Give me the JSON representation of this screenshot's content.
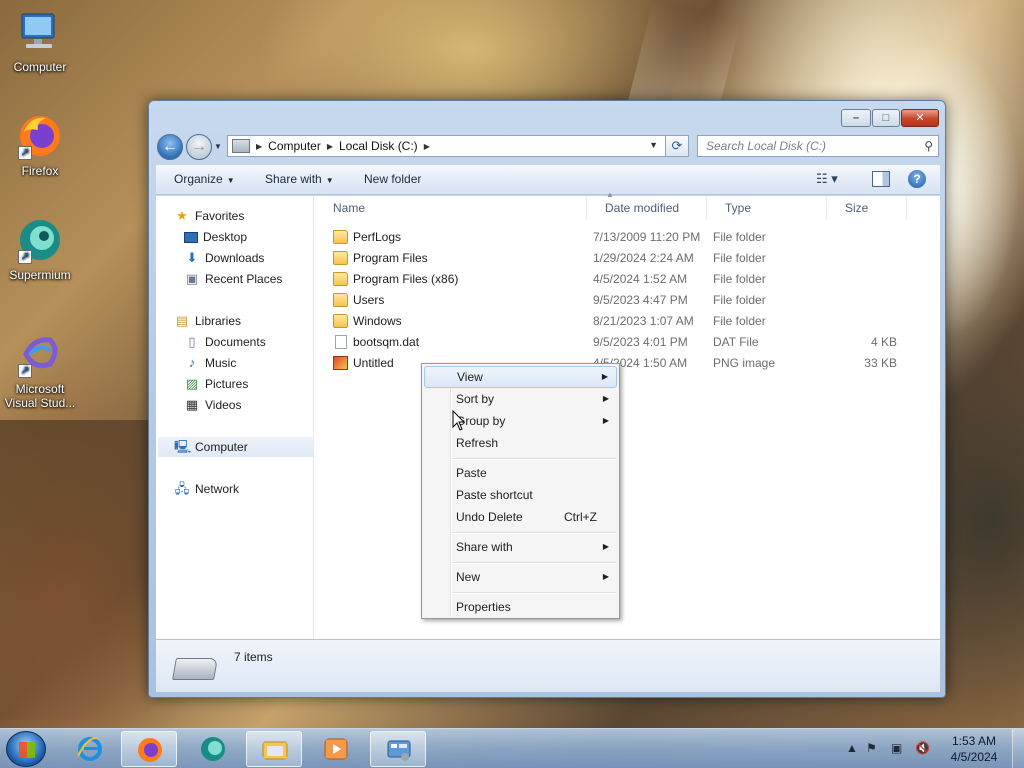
{
  "desktop": {
    "icons": [
      {
        "label": "Computer"
      },
      {
        "label": "Firefox"
      },
      {
        "label": "Supermium"
      },
      {
        "label": "Microsoft Visual Stud..."
      }
    ]
  },
  "window": {
    "controls": {
      "minimize": "–",
      "maximize": "□",
      "close": "✕"
    },
    "address": {
      "crumbs": [
        "Computer",
        "Local Disk (C:)"
      ]
    },
    "search": {
      "placeholder": "Search Local Disk (C:)"
    },
    "toolbar": {
      "organize": "Organize",
      "share_with": "Share with",
      "new_folder": "New folder"
    },
    "navpane": {
      "favorites": "Favorites",
      "desktop": "Desktop",
      "downloads": "Downloads",
      "recent_places": "Recent Places",
      "libraries": "Libraries",
      "documents": "Documents",
      "music": "Music",
      "pictures": "Pictures",
      "videos": "Videos",
      "computer": "Computer",
      "network": "Network"
    },
    "columns": {
      "name": "Name",
      "date": "Date modified",
      "type": "Type",
      "size": "Size"
    },
    "files": [
      {
        "name": "PerfLogs",
        "date": "7/13/2009 11:20 PM",
        "type": "File folder",
        "size": ""
      },
      {
        "name": "Program Files",
        "date": "1/29/2024 2:24 AM",
        "type": "File folder",
        "size": ""
      },
      {
        "name": "Program Files (x86)",
        "date": "4/5/2024 1:52 AM",
        "type": "File folder",
        "size": ""
      },
      {
        "name": "Users",
        "date": "9/5/2023 4:47 PM",
        "type": "File folder",
        "size": ""
      },
      {
        "name": "Windows",
        "date": "8/21/2023 1:07 AM",
        "type": "File folder",
        "size": ""
      },
      {
        "name": "bootsqm.dat",
        "date": "9/5/2023 4:01 PM",
        "type": "DAT File",
        "size": "4 KB"
      },
      {
        "name": "Untitled",
        "date": "4/5/2024 1:50 AM",
        "type": "PNG image",
        "size": "33 KB"
      }
    ],
    "status": {
      "items": "7 items"
    }
  },
  "context_menu": {
    "view": "View",
    "sort_by": "Sort by",
    "group_by": "Group by",
    "refresh": "Refresh",
    "paste": "Paste",
    "paste_shortcut": "Paste shortcut",
    "undo_delete": "Undo Delete",
    "undo_shortcut": "Ctrl+Z",
    "share_with": "Share with",
    "new": "New",
    "properties": "Properties"
  },
  "taskbar": {
    "clock_time": "1:53 AM",
    "clock_date": "4/5/2024"
  },
  "colors": {
    "accent": "#2f6fb8",
    "menu_highlight": "#dbe8f7",
    "close_button": "#c9452b"
  }
}
